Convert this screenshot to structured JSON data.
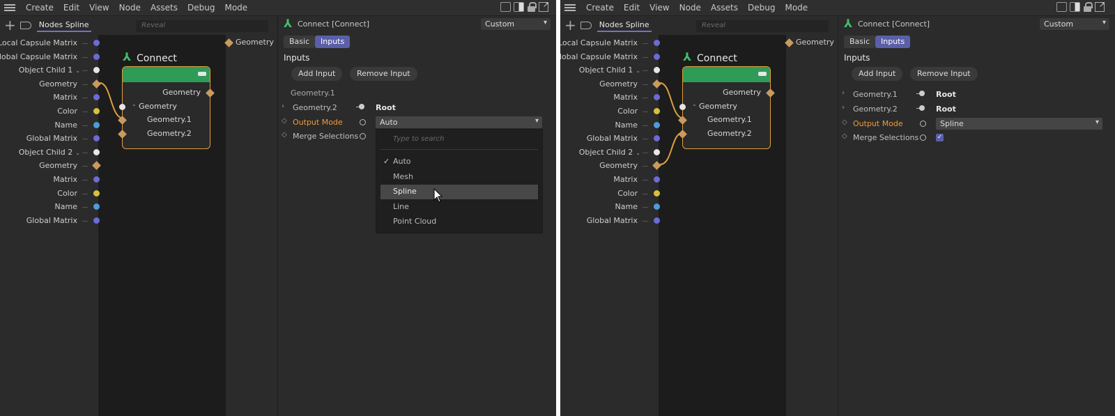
{
  "menu": [
    "Create",
    "Edit",
    "View",
    "Node",
    "Assets",
    "Debug",
    "Mode"
  ],
  "graph": {
    "tab": "Nodes Spline",
    "reveal_placeholder": "Reveal"
  },
  "ports": [
    {
      "label": "Local Capsule Matrix",
      "kind": "dot",
      "color": "#6b6bd6"
    },
    {
      "label": "Global Capsule Matrix",
      "kind": "dot",
      "color": "#6b6bd6"
    },
    {
      "label": "Object Child 1",
      "kind": "dot",
      "color": "#e6e6e6",
      "chev": true
    },
    {
      "label": "Geometry",
      "kind": "dia",
      "color": "#c99a5f"
    },
    {
      "label": "Matrix",
      "kind": "dot",
      "color": "#6b6bd6"
    },
    {
      "label": "Color",
      "kind": "dot",
      "color": "#d6c13e"
    },
    {
      "label": "Name",
      "kind": "dot",
      "color": "#4f9bd8"
    },
    {
      "label": "Global Matrix",
      "kind": "dot",
      "color": "#6b6bd6"
    },
    {
      "label": "Object Child 2",
      "kind": "dot",
      "color": "#e6e6e6",
      "chev": true
    },
    {
      "label": "Geometry",
      "kind": "dia",
      "color": "#c99a5f"
    },
    {
      "label": "Matrix",
      "kind": "dot",
      "color": "#6b6bd6"
    },
    {
      "label": "Color",
      "kind": "dot",
      "color": "#d6c13e"
    },
    {
      "label": "Name",
      "kind": "dot",
      "color": "#4f9bd8"
    },
    {
      "label": "Global Matrix",
      "kind": "dot",
      "color": "#6b6bd6"
    }
  ],
  "right_port": "Geometry",
  "node": {
    "title": "Connect",
    "out": "Geometry",
    "in_group": "Geometry",
    "in1": "Geometry.1",
    "in2": "Geometry.2"
  },
  "attr": {
    "title": "Connect [Connect]",
    "layout": "Custom",
    "tab_basic": "Basic",
    "tab_inputs": "Inputs",
    "section": "Inputs",
    "add_input": "Add Input",
    "remove_input": "Remove Input"
  },
  "left": {
    "geo1_label": "Geometry.1",
    "geo2_label": "Geometry.2",
    "geo2_value": "Root",
    "output_label": "Output Mode",
    "output_value": "Auto",
    "merge_label": "Merge Selections",
    "dropdown": {
      "placeholder": "Type to search",
      "items": [
        "Auto",
        "Mesh",
        "Spline",
        "Line",
        "Point Cloud"
      ],
      "checked": "Auto",
      "hover": "Spline"
    }
  },
  "right": {
    "geo1_label": "Geometry.1",
    "geo1_value": "Root",
    "geo2_label": "Geometry.2",
    "geo2_value": "Root",
    "output_label": "Output Mode",
    "output_value": "Spline",
    "merge_label": "Merge Selections",
    "merge_checked": true
  },
  "colors": {
    "accent": "#5a5fa8",
    "node_head": "#2e9b57",
    "wire": "#e0a03c",
    "highlight": "#f39a35"
  }
}
